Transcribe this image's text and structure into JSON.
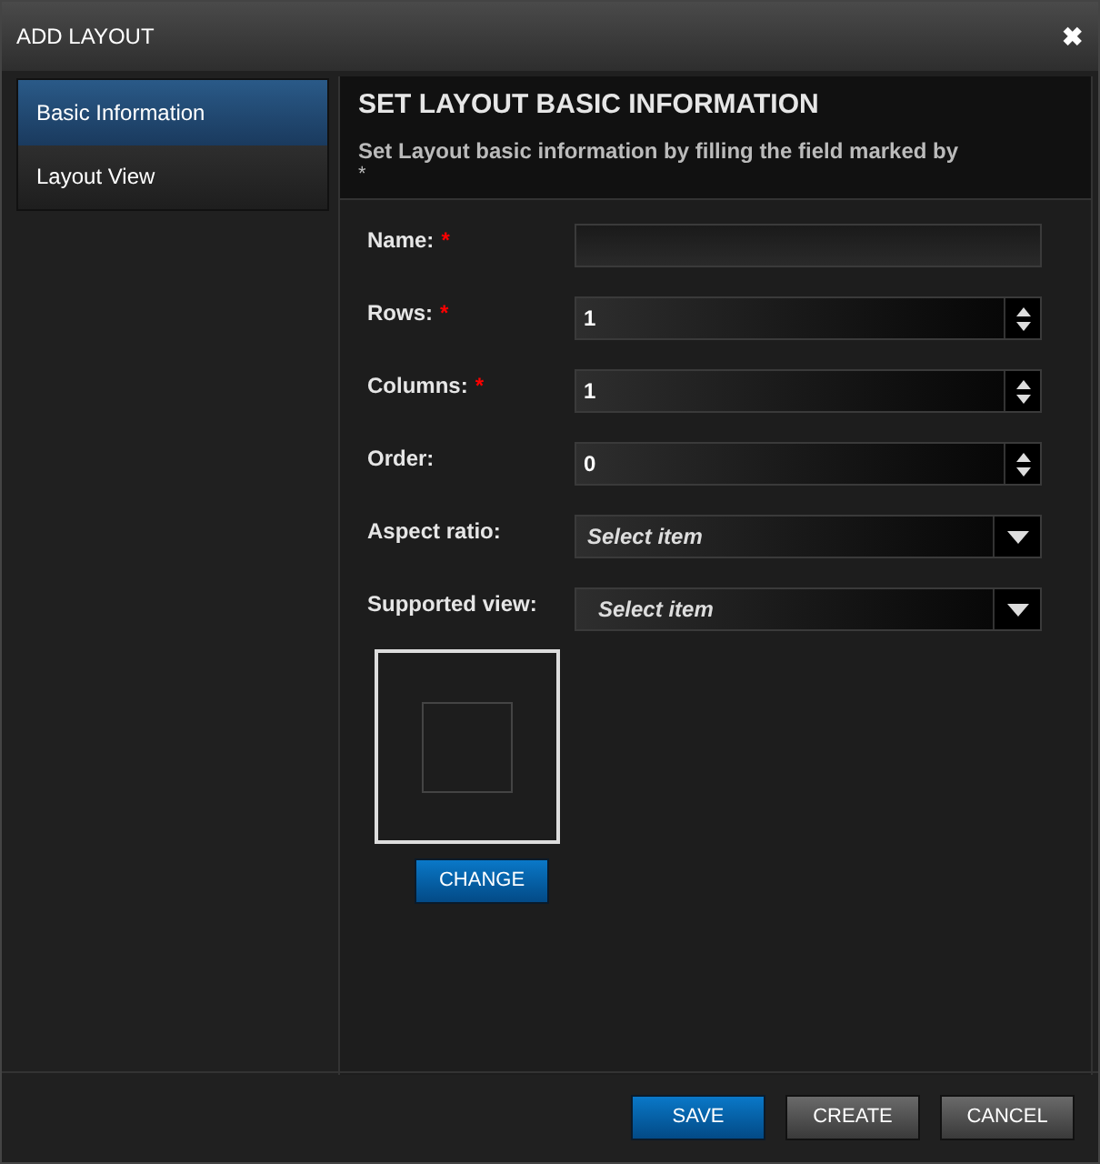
{
  "window": {
    "title": "ADD LAYOUT",
    "close": "✖"
  },
  "sidebar": {
    "items": [
      {
        "label": "Basic Information",
        "selected": true
      },
      {
        "label": "Layout View",
        "selected": false
      }
    ]
  },
  "header": {
    "title": "SET LAYOUT BASIC INFORMATION",
    "subtitle": "Set Layout basic information by filling the field marked by",
    "subtitle_mark": "*"
  },
  "fields": [
    {
      "label": "Name:",
      "required": true,
      "kind": "text"
    },
    {
      "label": "Rows:",
      "required": true,
      "kind": "spinner",
      "value": "1"
    },
    {
      "label": "Columns:",
      "required": true,
      "kind": "spinner",
      "value": "1"
    },
    {
      "label": "Order:",
      "required": false,
      "kind": "spinner",
      "value": "0"
    },
    {
      "label": "Aspect ratio:",
      "required": false,
      "kind": "select",
      "placeholder": "Select item"
    },
    {
      "label": "Supported view:",
      "required": false,
      "kind": "select",
      "placeholder": "Select item"
    }
  ],
  "required_mark": "*",
  "preview": {
    "button": "CHANGE"
  },
  "footer": {
    "buttons": [
      {
        "label": "SAVE",
        "kind": "primary"
      },
      {
        "label": "CREATE",
        "kind": "secondary"
      },
      {
        "label": "CANCEL",
        "kind": "secondary"
      }
    ]
  }
}
